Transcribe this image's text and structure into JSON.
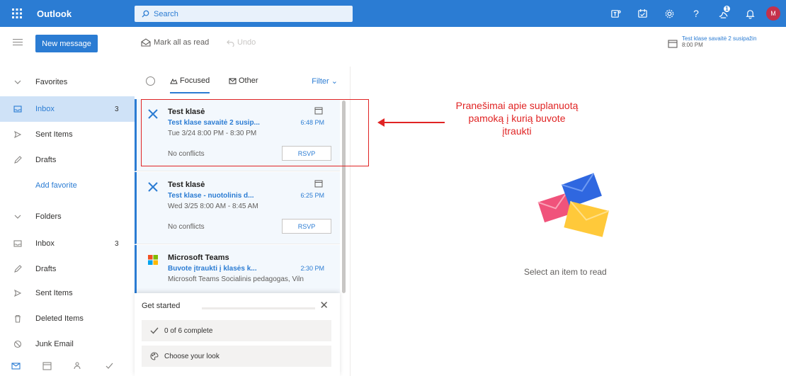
{
  "topbar": {
    "app_name": "Outlook",
    "search_placeholder": "Search",
    "avatar_initials": "M",
    "icons": [
      "waffle-icon",
      "teams-icon",
      "bookings-icon",
      "settings-icon",
      "help-icon",
      "feedback-icon",
      "notification-icon"
    ],
    "accent": "#2b7cd3"
  },
  "cmdbar": {
    "new_message": "New message",
    "mark_all_read": "Mark all as read",
    "undo": "Undo",
    "reminder_title": "Test klase savaitė 2 susipažin",
    "reminder_time": "8:00 PM"
  },
  "nav": {
    "favorites": "Favorites",
    "inbox": "Inbox",
    "inbox_count": "3",
    "sent": "Sent Items",
    "drafts": "Drafts",
    "add_favorite": "Add favorite",
    "folders": "Folders",
    "f_inbox": "Inbox",
    "f_inbox_count": "3",
    "f_drafts": "Drafts",
    "f_sent": "Sent Items",
    "f_deleted": "Deleted Items",
    "f_junk": "Junk Email"
  },
  "list": {
    "tab_focused": "Focused",
    "tab_other": "Other",
    "filter": "Filter",
    "messages": [
      {
        "sender": "Test klasė",
        "subject": "Test klase savaitė 2 susip...",
        "time": "6:48 PM",
        "detail": "Tue 3/24 8:00 PM - 8:30 PM",
        "conflicts": "No conflicts",
        "rsvp": "RSVP"
      },
      {
        "sender": "Test klasė",
        "subject": "Test klase - nuotolinis d...",
        "time": "6:25 PM",
        "detail": "Wed 3/25 8:00 AM - 8:45 AM",
        "conflicts": "No conflicts",
        "rsvp": "RSVP"
      },
      {
        "sender": "Microsoft Teams",
        "subject": "Buvote įtraukti į klasės k...",
        "time": "2:30 PM",
        "detail": "Microsoft Teams Socialinis pedagogas, Viln"
      }
    ]
  },
  "get_started": {
    "title": "Get started",
    "progress": "0 of 6 complete",
    "choose_look": "Choose your look"
  },
  "reading": {
    "annotation": "Pranešimai apie suplanuotą pamoką į kurią buvote įtraukti",
    "empty_text": "Select an item to read"
  }
}
